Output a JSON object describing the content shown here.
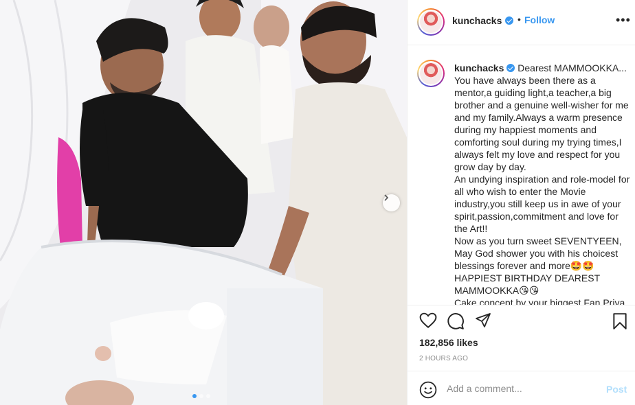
{
  "post": {
    "username": "kunchacks",
    "follow_label": "Follow",
    "separator": "•",
    "more_glyph": "•••",
    "caption_text": " Dearest MAMMOOKKA...\nYou have always been there as a mentor,a guiding light,a teacher,a big brother and a genuine well-wisher for me and my family.Always a warm presence during my happiest moments and comforting soul during my trying times,I always felt my love and respect for you grow day by day.\nAn undying inspiration and role-model for all who wish to enter the Movie industry,you still keep us in awe of your spirit,passion,commitment and love for the Art!!\nNow as you turn sweet SEVENTYEEN, May God shower you with his choicest blessings forever and more🤩🤩\nHAPPIEST BIRTHDAY DEAREST MAMMOOKKA😘😘\nCake concept by your biggest Fan Priya",
    "likes": "182,856 likes",
    "timestamp": "2 hours ago",
    "comment_placeholder": "Add a comment...",
    "post_label": "Post",
    "carousel": {
      "count": 3,
      "active_index": 0
    }
  },
  "icons": {
    "like": "heart-icon",
    "comment": "comment-icon",
    "share": "paper-plane-icon",
    "save": "bookmark-icon",
    "emoji": "smiley-icon",
    "next": "chevron-right-icon",
    "verified": "verified-badge-icon"
  },
  "colors": {
    "accent": "#3897f0",
    "post_disabled": "#b2dffc",
    "muted": "#8e8e8e",
    "text": "#262626"
  }
}
